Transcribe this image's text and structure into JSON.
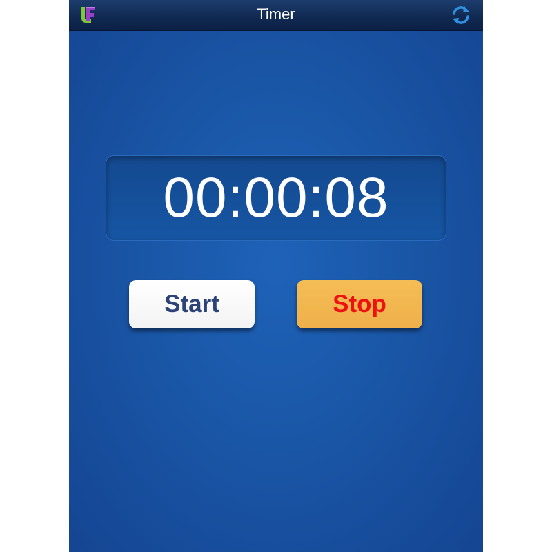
{
  "navbar": {
    "title": "Timer",
    "logo_icon": "app-logo-icon",
    "refresh_icon": "refresh-icon"
  },
  "timer": {
    "display": "00:00:08"
  },
  "buttons": {
    "start_label": "Start",
    "stop_label": "Stop"
  },
  "colors": {
    "navbar": "#112a52",
    "background": "#1a56a6",
    "start_text": "#2c4378",
    "stop_bg": "#f2b550",
    "stop_text": "#ee1111"
  }
}
